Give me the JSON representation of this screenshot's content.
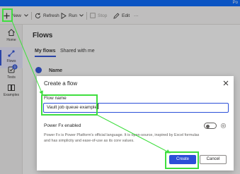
{
  "titlebar": {
    "text": "Po"
  },
  "toolbar": {
    "new_label": "New",
    "refresh_label": "Refresh",
    "run_label": "Run",
    "stop_label": "Stop",
    "edit_label": "Edit",
    "more_label": "···"
  },
  "sidebar": {
    "items": [
      {
        "label": "Home",
        "icon": "home-icon"
      },
      {
        "label": "Flows",
        "icon": "flows-icon"
      },
      {
        "label": "Tests",
        "icon": "tests-icon"
      },
      {
        "label": "Examples",
        "icon": "examples-icon"
      }
    ],
    "badge": "0"
  },
  "main": {
    "title": "Flows",
    "tabs": [
      {
        "label": "My flows"
      },
      {
        "label": "Shared with me"
      }
    ],
    "column_name": "Name"
  },
  "dialog": {
    "title": "Create a flow",
    "field_label": "Flow name",
    "field_value": "Vault job queue example",
    "fx_label": "Power Fx enabled",
    "fx_description": "Power Fx is Power Platform's official language. It is open-source, inspired by Excel formulas and has simplicity and ease-of-use as its core values.",
    "create_label": "Create",
    "cancel_label": "Cancel"
  },
  "colors": {
    "accent": "#2b4fd8",
    "highlight": "#3fde3f",
    "titlebar": "#0066ff"
  }
}
